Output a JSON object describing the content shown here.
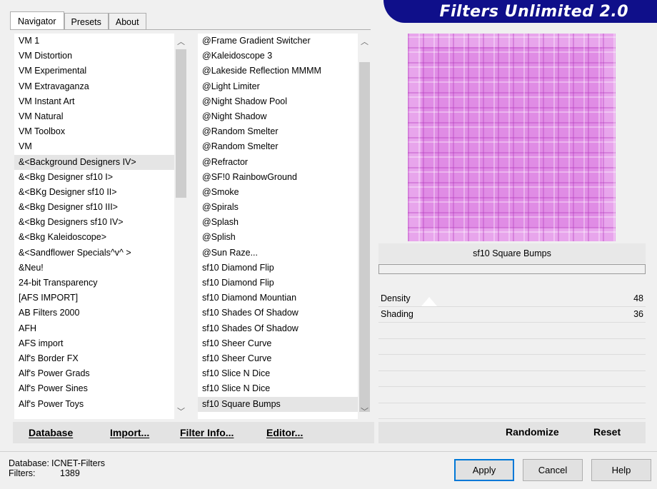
{
  "tabs": [
    "Navigator",
    "Presets",
    "About"
  ],
  "banner": "Filters Unlimited 2.0",
  "categories": [
    "VM 1",
    "VM Distortion",
    "VM Experimental",
    "VM Extravaganza",
    "VM Instant Art",
    "VM Natural",
    "VM Toolbox",
    "VM",
    "&<Background Designers IV>",
    "&<Bkg Designer sf10 I>",
    "&<BKg Designer sf10 II>",
    "&<Bkg Designer sf10 III>",
    "&<Bkg Designers sf10 IV>",
    "&<Bkg Kaleidoscope>",
    "&<Sandflower Specials^v^ >",
    "&Neu!",
    "24-bit Transparency",
    "[AFS IMPORT]",
    "AB Filters 2000",
    "AFH",
    "AFS import",
    "Alf's Border FX",
    "Alf's Power Grads",
    "Alf's Power Sines",
    "Alf's Power Toys"
  ],
  "categories_selected": 8,
  "filters": [
    "@Frame Gradient Switcher",
    "@Kaleidoscope 3",
    "@Lakeside Reflection MMMM",
    "@Light Limiter",
    "@Night Shadow Pool",
    "@Night Shadow",
    "@Random Smelter",
    "@Random Smelter",
    "@Refractor",
    "@SF!0 RainbowGround",
    "@Smoke",
    "@Spirals",
    "@Splash",
    "@Splish",
    "@Sun Raze...",
    "sf10 Diamond Flip",
    "sf10 Diamond Flip",
    "sf10 Diamond Mountian",
    "sf10 Shades Of Shadow",
    "sf10 Shades Of Shadow",
    "sf10 Sheer Curve",
    "sf10 Sheer Curve",
    "sf10 Slice N Dice",
    "sf10 Slice N Dice",
    "sf10 Square Bumps"
  ],
  "filters_selected": 24,
  "left_buttons": {
    "database": "Database",
    "import": "Import...",
    "filter_info": "Filter Info...",
    "editor": "Editor..."
  },
  "filter_name": "sf10 Square Bumps",
  "params": [
    {
      "name": "Density",
      "value": "48"
    },
    {
      "name": "Shading",
      "value": "36"
    }
  ],
  "right_buttons": {
    "randomize": "Randomize",
    "reset": "Reset"
  },
  "status": {
    "database_label": "Database:",
    "database_value": "ICNET-Filters",
    "filters_label": "Filters:",
    "filters_value": "1389"
  },
  "dialog_buttons": {
    "apply": "Apply",
    "cancel": "Cancel",
    "help": "Help"
  },
  "preview_color": "#e8a5ec",
  "accent_color": "#0f0f8a"
}
